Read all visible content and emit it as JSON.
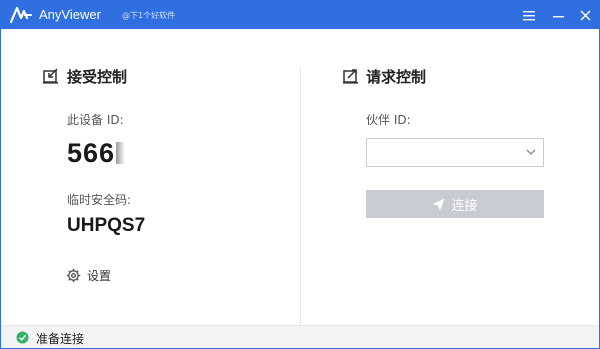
{
  "titlebar": {
    "app_name": "AnyViewer",
    "watermark": "@下1个好软件"
  },
  "left_panel": {
    "title": "接受控制",
    "device_id_label": "此设备 ID:",
    "device_id_value": "566",
    "password_label": "临时安全码:",
    "password_value": "UHPQS7",
    "settings_label": "设置"
  },
  "right_panel": {
    "title": "请求控制",
    "partner_id_label": "伙伴 ID:",
    "partner_id_value": "",
    "connect_label": "连接"
  },
  "status": {
    "text": "准备连接"
  },
  "colors": {
    "titlebar": "#2f6fe0",
    "connect_disabled": "#c8cbd1",
    "status_ok": "#2fb36b"
  }
}
